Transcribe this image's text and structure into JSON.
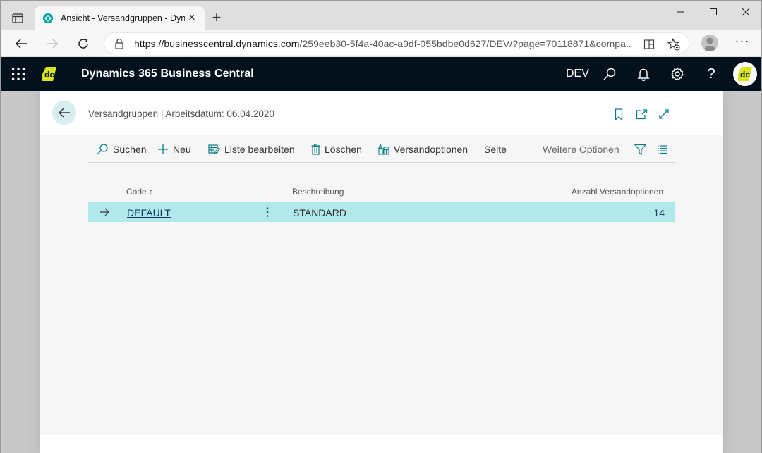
{
  "browser": {
    "tab_title": "Ansicht - Versandgruppen - Dyna",
    "url_host": "https://businesscentral.dynamics.com",
    "url_path": "/259eeb30-5f4a-40ac-a9df-055bdbe0d627/DEV/?page=70118871&compa..."
  },
  "app": {
    "title": "Dynamics 365 Business Central",
    "environment": "DEV",
    "help": "?"
  },
  "page": {
    "caption": "Versandgruppen | Arbeitsdatum: 06.04.2020"
  },
  "actions": {
    "search": "Suchen",
    "new": "Neu",
    "edit_list": "Liste bearbeiten",
    "delete": "Löschen",
    "shipping_options": "Versandoptionen",
    "page": "Seite",
    "more_options": "Weitere Optionen"
  },
  "grid": {
    "columns": {
      "code": "Code ↑",
      "description": "Beschreibung",
      "count": "Anzahl Versandoptionen"
    },
    "rows": [
      {
        "code": "DEFAULT",
        "description": "STANDARD",
        "count": "14"
      }
    ]
  },
  "colors": {
    "appbar": "#03111d",
    "selected_row": "#b1e8ea",
    "accent": "#00a3a3",
    "logo": "#d6e51d"
  }
}
